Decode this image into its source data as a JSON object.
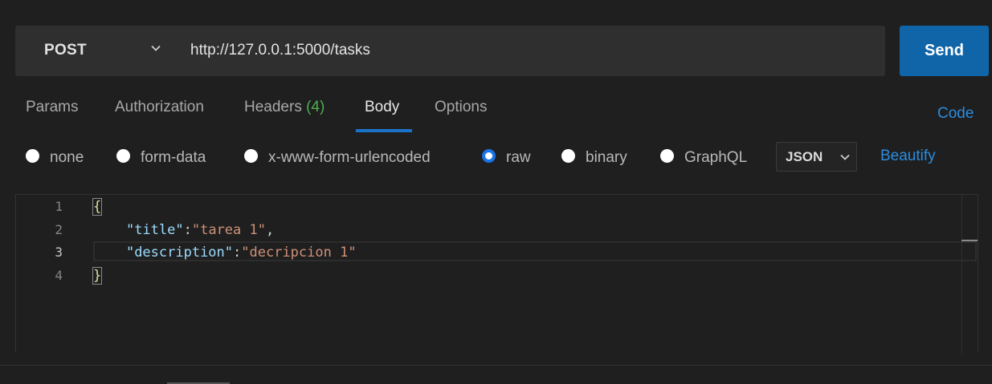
{
  "request": {
    "method": "POST",
    "url": "http://127.0.0.1:5000/tasks",
    "send_label": "Send"
  },
  "tabs": [
    {
      "label": "Params"
    },
    {
      "label": "Authorization"
    },
    {
      "label": "Headers",
      "count": "(4)"
    },
    {
      "label": "Body",
      "active": true
    },
    {
      "label": "Options"
    }
  ],
  "code_link": "Code",
  "body_types": [
    {
      "label": "none",
      "checked": false
    },
    {
      "label": "form-data",
      "checked": false
    },
    {
      "label": "x-www-form-urlencoded",
      "checked": false
    },
    {
      "label": "raw",
      "checked": true
    },
    {
      "label": "binary",
      "checked": false
    },
    {
      "label": "GraphQL",
      "checked": false
    }
  ],
  "format": "JSON",
  "beautify_label": "Beautify",
  "editor": {
    "line_numbers": [
      "1",
      "2",
      "3",
      "4"
    ],
    "current_line": "3",
    "lines": {
      "l1_brace": "{",
      "l2_key": "\"title\"",
      "l2_colon": ":",
      "l2_value": "\"tarea 1\"",
      "l2_comma": ",",
      "l3_key": "\"description\"",
      "l3_colon": ":",
      "l3_value": "\"decripcion 1\"",
      "l4_brace": "}"
    }
  },
  "colors": {
    "accent": "#1065a8",
    "link": "#2a8ce0",
    "headers_count": "#4caf50",
    "json_key": "#9cdcfe",
    "json_string": "#ce9178"
  }
}
